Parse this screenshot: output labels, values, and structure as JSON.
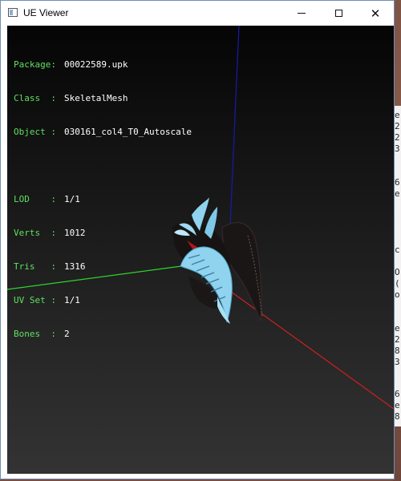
{
  "window": {
    "title": "UE Viewer",
    "icon": "app-window-icon",
    "minimize_glyph": "minimize-icon",
    "maximize_glyph": "maximize-icon",
    "close_glyph": "close-icon",
    "close_char": "✕"
  },
  "info": {
    "package_label": "Package:",
    "package_value": "00022589.upk",
    "class_label": "Class  :",
    "class_value": "SkeletalMesh",
    "object_label": "Object :",
    "object_value": "030161_col4_T0_Autoscale",
    "lod_label": "LOD    :",
    "lod_value": "1/1",
    "verts_label": "Verts  :",
    "verts_value": "1012",
    "tris_label": "Tris   :",
    "tris_value": "1316",
    "uvset_label": "UV Set :",
    "uvset_value": "1/1",
    "bones_label": "Bones  :",
    "bones_value": "2"
  },
  "colors": {
    "label_green": "#5fe05f",
    "axis_x": "#cc2020",
    "axis_y": "#2fd22f",
    "axis_z": "#1a1aa8",
    "mesh_light": "#8fd3ef",
    "mesh_dark": "#1a1616"
  },
  "background": {
    "right_glyphs": [
      "e",
      "2",
      "2",
      "3",
      "6",
      "e",
      "c",
      "O",
      "(",
      "o",
      "e",
      "2",
      "8",
      "3",
      "6",
      "e",
      "8"
    ]
  }
}
